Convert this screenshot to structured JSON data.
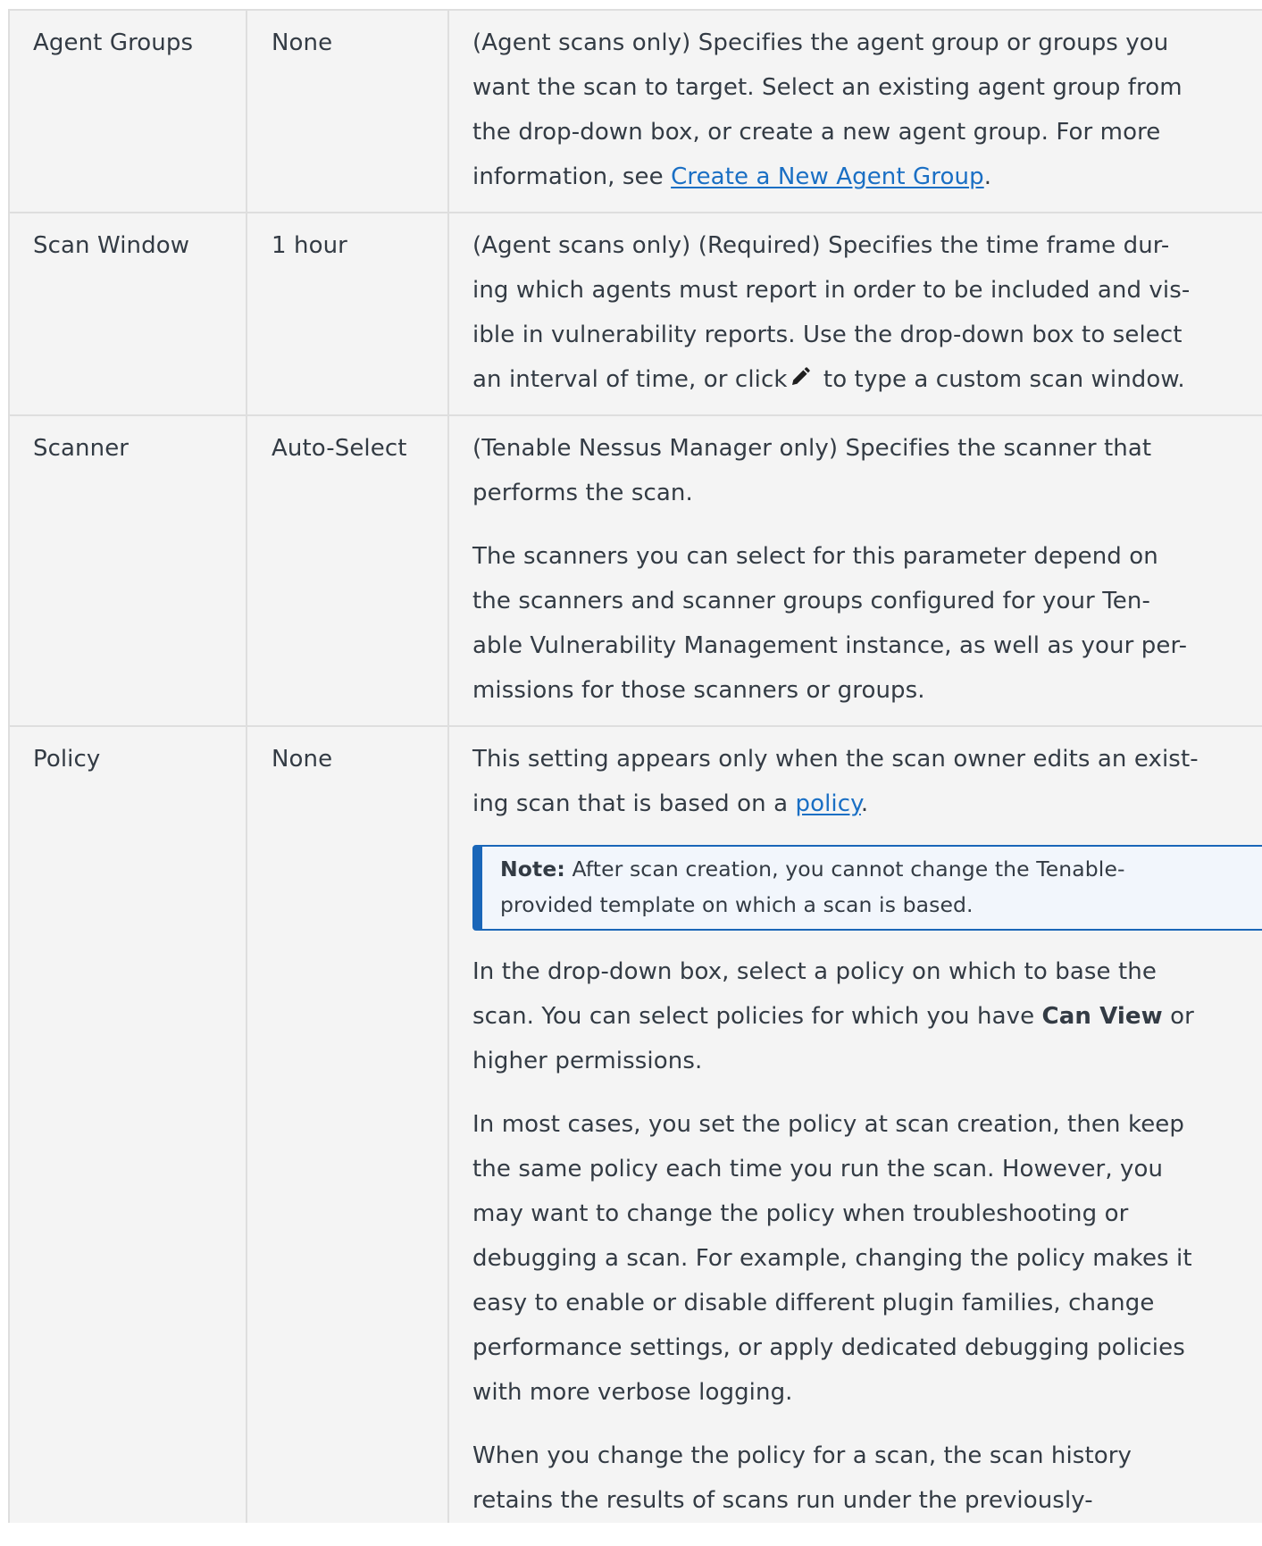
{
  "rows": [
    {
      "name": "Agent Groups",
      "default": "None",
      "description": {
        "lines": [
          "(Agent scans only) Specifies the agent group or groups you",
          "want the scan to target. Select an existing agent group from",
          "the drop-down box, or create a new agent group. For more"
        ],
        "last_prefix": "information, see ",
        "link_text": "Create a New Agent Group",
        "last_suffix": "."
      }
    },
    {
      "name": "Scan Window",
      "default": "1 hour",
      "description": {
        "lines": [
          "(Agent scans only) (Required) Specifies the time frame dur-",
          "ing which agents must report in order to be included and vis-",
          "ible in vulnerability reports. Use the drop-down box to select"
        ],
        "last_prefix": "an interval of time, or click",
        "icon": "pencil-icon",
        "last_suffix": " to type a custom scan window."
      }
    },
    {
      "name": "Scanner",
      "default": "Auto-Select",
      "description": {
        "p1": [
          "(Tenable Nessus Manager only) Specifies the scanner that",
          "performs the scan."
        ],
        "p2": [
          "The scanners you can select for this parameter depend on",
          "the scanners and scanner groups configured for your Ten-",
          "able Vulnerability Management instance, as well as your per-",
          "missions for those scanners or groups."
        ]
      }
    },
    {
      "name": "Policy",
      "default": "None",
      "description": {
        "p1_line1": "This setting appears only when the scan owner edits an exist-",
        "p1_line2_prefix": "ing scan that is based on a ",
        "p1_link": "policy",
        "p1_line2_suffix": ".",
        "note": {
          "label": "Note:",
          "line1": " After scan creation, you cannot change the Tenable-",
          "line2": "provided template on which a scan is based."
        },
        "p2_line1": "In the drop-down box, select a policy on which to base the",
        "p2_line2_prefix": "scan. You can select policies for which you have ",
        "p2_bold": "Can View",
        "p2_line2_suffix": " or",
        "p2_line3": "higher permissions.",
        "p3": [
          "In most cases, you set the policy at scan creation, then keep",
          "the same policy each time you run the scan. However, you",
          "may want to change the policy when troubleshooting or",
          "debugging a scan. For example, changing the policy makes it",
          "easy to enable or disable different plugin families, change",
          "performance settings, or apply dedicated debugging policies",
          "with more verbose logging."
        ],
        "p4": [
          "When you change the policy for a scan, the scan history",
          "retains the results of scans run under the previously-"
        ]
      }
    }
  ],
  "colors": {
    "link": "#1a6fc4",
    "note_border": "#1a66b8",
    "cell_background": "#f4f4f4",
    "border": "#dedede"
  }
}
